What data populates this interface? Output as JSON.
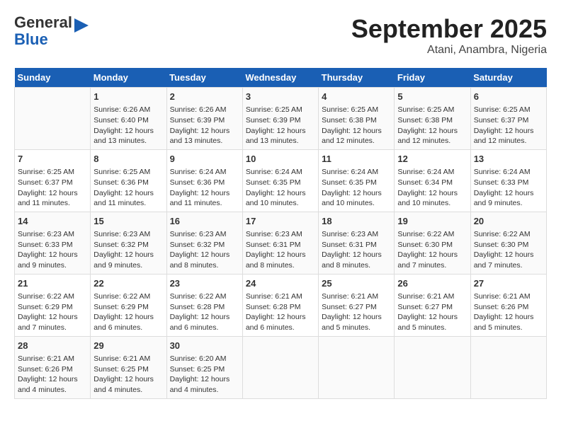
{
  "logo": {
    "line1": "General",
    "line2": "Blue"
  },
  "title": "September 2025",
  "subtitle": "Atani, Anambra, Nigeria",
  "days_of_week": [
    "Sunday",
    "Monday",
    "Tuesday",
    "Wednesday",
    "Thursday",
    "Friday",
    "Saturday"
  ],
  "weeks": [
    [
      {
        "day": "",
        "info": ""
      },
      {
        "day": "1",
        "info": "Sunrise: 6:26 AM\nSunset: 6:40 PM\nDaylight: 12 hours\nand 13 minutes."
      },
      {
        "day": "2",
        "info": "Sunrise: 6:26 AM\nSunset: 6:39 PM\nDaylight: 12 hours\nand 13 minutes."
      },
      {
        "day": "3",
        "info": "Sunrise: 6:25 AM\nSunset: 6:39 PM\nDaylight: 12 hours\nand 13 minutes."
      },
      {
        "day": "4",
        "info": "Sunrise: 6:25 AM\nSunset: 6:38 PM\nDaylight: 12 hours\nand 12 minutes."
      },
      {
        "day": "5",
        "info": "Sunrise: 6:25 AM\nSunset: 6:38 PM\nDaylight: 12 hours\nand 12 minutes."
      },
      {
        "day": "6",
        "info": "Sunrise: 6:25 AM\nSunset: 6:37 PM\nDaylight: 12 hours\nand 12 minutes."
      }
    ],
    [
      {
        "day": "7",
        "info": "Sunrise: 6:25 AM\nSunset: 6:37 PM\nDaylight: 12 hours\nand 11 minutes."
      },
      {
        "day": "8",
        "info": "Sunrise: 6:25 AM\nSunset: 6:36 PM\nDaylight: 12 hours\nand 11 minutes."
      },
      {
        "day": "9",
        "info": "Sunrise: 6:24 AM\nSunset: 6:36 PM\nDaylight: 12 hours\nand 11 minutes."
      },
      {
        "day": "10",
        "info": "Sunrise: 6:24 AM\nSunset: 6:35 PM\nDaylight: 12 hours\nand 10 minutes."
      },
      {
        "day": "11",
        "info": "Sunrise: 6:24 AM\nSunset: 6:35 PM\nDaylight: 12 hours\nand 10 minutes."
      },
      {
        "day": "12",
        "info": "Sunrise: 6:24 AM\nSunset: 6:34 PM\nDaylight: 12 hours\nand 10 minutes."
      },
      {
        "day": "13",
        "info": "Sunrise: 6:24 AM\nSunset: 6:33 PM\nDaylight: 12 hours\nand 9 minutes."
      }
    ],
    [
      {
        "day": "14",
        "info": "Sunrise: 6:23 AM\nSunset: 6:33 PM\nDaylight: 12 hours\nand 9 minutes."
      },
      {
        "day": "15",
        "info": "Sunrise: 6:23 AM\nSunset: 6:32 PM\nDaylight: 12 hours\nand 9 minutes."
      },
      {
        "day": "16",
        "info": "Sunrise: 6:23 AM\nSunset: 6:32 PM\nDaylight: 12 hours\nand 8 minutes."
      },
      {
        "day": "17",
        "info": "Sunrise: 6:23 AM\nSunset: 6:31 PM\nDaylight: 12 hours\nand 8 minutes."
      },
      {
        "day": "18",
        "info": "Sunrise: 6:23 AM\nSunset: 6:31 PM\nDaylight: 12 hours\nand 8 minutes."
      },
      {
        "day": "19",
        "info": "Sunrise: 6:22 AM\nSunset: 6:30 PM\nDaylight: 12 hours\nand 7 minutes."
      },
      {
        "day": "20",
        "info": "Sunrise: 6:22 AM\nSunset: 6:30 PM\nDaylight: 12 hours\nand 7 minutes."
      }
    ],
    [
      {
        "day": "21",
        "info": "Sunrise: 6:22 AM\nSunset: 6:29 PM\nDaylight: 12 hours\nand 7 minutes."
      },
      {
        "day": "22",
        "info": "Sunrise: 6:22 AM\nSunset: 6:29 PM\nDaylight: 12 hours\nand 6 minutes."
      },
      {
        "day": "23",
        "info": "Sunrise: 6:22 AM\nSunset: 6:28 PM\nDaylight: 12 hours\nand 6 minutes."
      },
      {
        "day": "24",
        "info": "Sunrise: 6:21 AM\nSunset: 6:28 PM\nDaylight: 12 hours\nand 6 minutes."
      },
      {
        "day": "25",
        "info": "Sunrise: 6:21 AM\nSunset: 6:27 PM\nDaylight: 12 hours\nand 5 minutes."
      },
      {
        "day": "26",
        "info": "Sunrise: 6:21 AM\nSunset: 6:27 PM\nDaylight: 12 hours\nand 5 minutes."
      },
      {
        "day": "27",
        "info": "Sunrise: 6:21 AM\nSunset: 6:26 PM\nDaylight: 12 hours\nand 5 minutes."
      }
    ],
    [
      {
        "day": "28",
        "info": "Sunrise: 6:21 AM\nSunset: 6:26 PM\nDaylight: 12 hours\nand 4 minutes."
      },
      {
        "day": "29",
        "info": "Sunrise: 6:21 AM\nSunset: 6:25 PM\nDaylight: 12 hours\nand 4 minutes."
      },
      {
        "day": "30",
        "info": "Sunrise: 6:20 AM\nSunset: 6:25 PM\nDaylight: 12 hours\nand 4 minutes."
      },
      {
        "day": "",
        "info": ""
      },
      {
        "day": "",
        "info": ""
      },
      {
        "day": "",
        "info": ""
      },
      {
        "day": "",
        "info": ""
      }
    ]
  ]
}
